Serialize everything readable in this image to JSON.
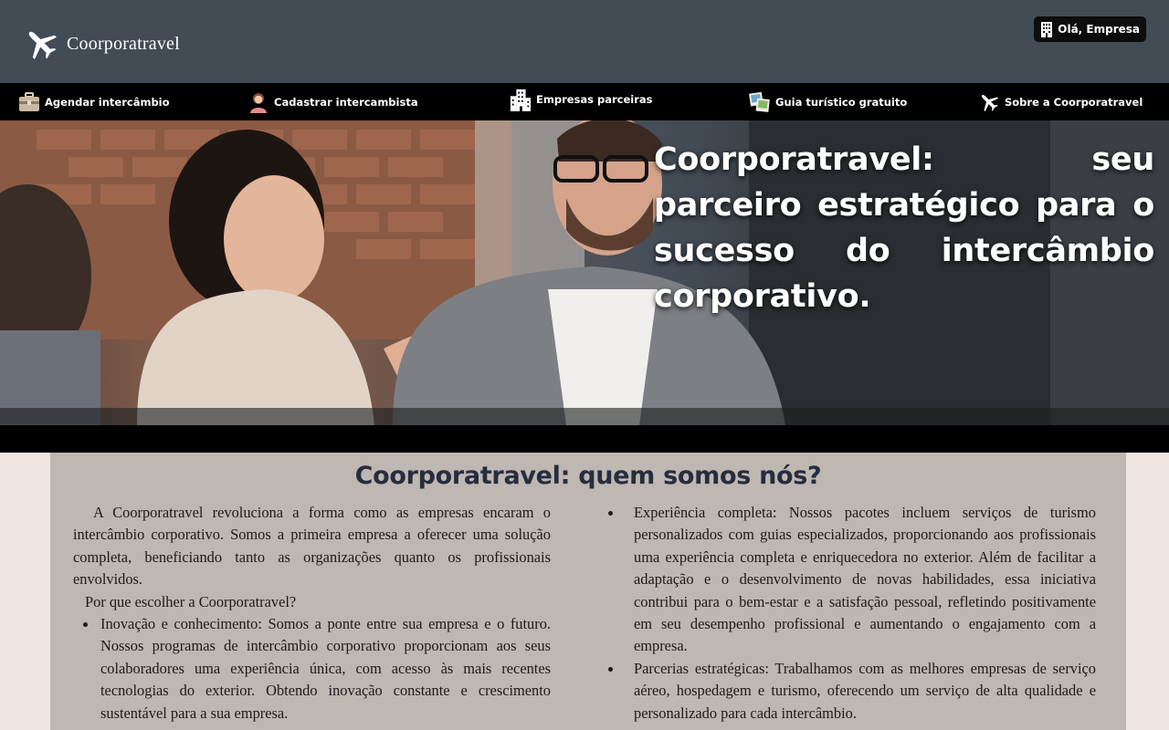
{
  "header": {
    "brand": "Coorporatravel",
    "user_greeting": "Olá, Empresa"
  },
  "nav": {
    "items": [
      {
        "label": "Agendar intercâmbio",
        "icon": "briefcase-icon"
      },
      {
        "label": "Cadastrar intercambista",
        "icon": "person-icon"
      },
      {
        "label": "Empresas parceiras",
        "icon": "building-icon"
      },
      {
        "label": "Guia turístico gratuito",
        "icon": "photos-icon"
      },
      {
        "label": "Sobre a Coorporatravel",
        "icon": "airplane-icon"
      }
    ]
  },
  "hero": {
    "title": "Coorporatravel: seu parceiro estratégico para o sucesso do intercâmbio corporativo."
  },
  "about": {
    "title": "Coorporatravel: quem somos nós?",
    "intro": "A Coorporatravel revoluciona a forma como as empresas encaram o intercâmbio corporativo. Somos a primeira empresa a oferecer uma solução completa, beneficiando tanto as organizações quanto os profissionais envolvidos.",
    "why": "Por que escolher a Coorporatravel?",
    "left_bullets": [
      "Inovação e conhecimento: Somos a ponte entre sua empresa e o futuro. Nossos programas de intercâmbio corporativo proporcionam aos seus colaboradores uma experiência única, com acesso às mais recentes tecnologias do exterior. Obtendo inovação constante e crescimento sustentável para a sua empresa."
    ],
    "right_bullets": [
      "Experiência completa: Nossos pacotes incluem serviços de turismo personalizados com guias especializados, proporcionando aos profissionais uma experiência completa e enriquecedora no exterior. Além de facilitar a adaptação e o desenvolvimento de novas habilidades, essa iniciativa contribui para o bem-estar e a satisfação pessoal, refletindo positivamente em seu desempenho profissional e aumentando o engajamento com a empresa.",
      "Parcerias estratégicas: Trabalhamos com as melhores empresas de serviço aéreo, hospedagem e turismo, oferecendo um serviço de alta qualidade e personalizado para cada intercâmbio."
    ]
  },
  "colors": {
    "header_bg": "#414c55",
    "nav_bg": "#000000",
    "page_bg": "#efe6e1",
    "about_bg": "#bfb7b1",
    "title_color": "#262e3e"
  }
}
